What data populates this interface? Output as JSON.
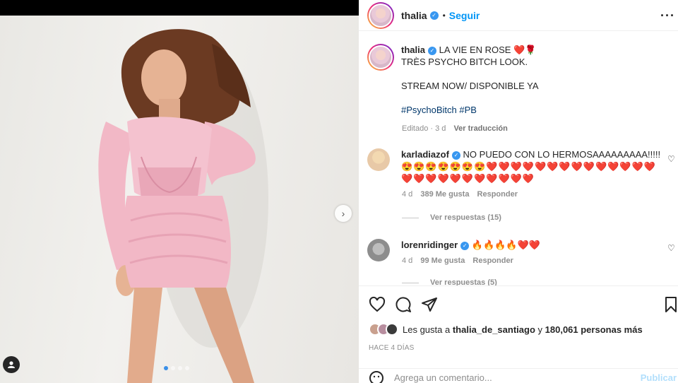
{
  "post": {
    "username": "thalia",
    "follow_label": "Seguir",
    "more_icon": "more-horizontal-icon",
    "caption_line1": "LA VIE EN ROSE ❤️🌹",
    "caption_line2": "TRÈS PSYCHO BITCH LOOK.",
    "caption_line3": "STREAM NOW/ DISPONIBLE YA",
    "caption_tags": "#PsychoBitch #PB",
    "caption_edited": "Editado · 3 d",
    "caption_translate": "Ver traducción"
  },
  "comments": [
    {
      "username": "karladiazof",
      "text": "NO PUEDO CON LO HERMOSAAAAAAAAA!!!!!",
      "emojis": "😍😍😍😍😍😍😍❤️❤️❤️❤️❤️❤️❤️❤️❤️❤️❤️❤️❤️❤️❤️❤️❤️❤️❤️❤️❤️❤️❤️❤️❤️",
      "age": "4 d",
      "likes": "389 Me gusta",
      "reply_label": "Responder",
      "view_replies": "Ver respuestas (15)"
    },
    {
      "username": "lorenridinger",
      "text": "🔥🔥🔥🔥❤️❤️",
      "age": "4 d",
      "likes": "99 Me gusta",
      "reply_label": "Responder",
      "view_replies": "Ver respuestas (5)"
    }
  ],
  "likes": {
    "prefix": "Les gusta a",
    "user": "thalia_de_santiago",
    "middle": "y",
    "count": "180,061 personas más"
  },
  "time_ago": "HACE 4 DÍAS",
  "add_comment": {
    "placeholder": "Agrega un comentario...",
    "publish_label": "Publicar"
  },
  "carousel": {
    "pages": 4,
    "current": 1
  },
  "colors": {
    "accent": "#0095f6",
    "verified": "#3897f0",
    "dress": "#f2b8c6"
  }
}
